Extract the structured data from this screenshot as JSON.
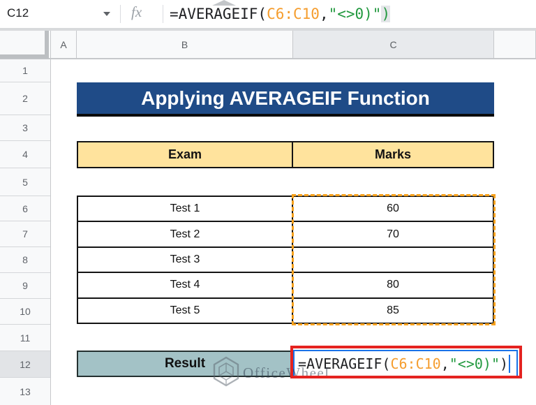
{
  "formula_bar": {
    "name_box": "C12",
    "fx_label": "fx",
    "segments": [
      {
        "t": "=AVERAGEIF(",
        "c": "ink"
      },
      {
        "t": "C6:C10",
        "c": "range"
      },
      {
        "t": ",",
        "c": "ink"
      },
      {
        "t": "\"<>0)\"",
        "c": "string"
      },
      {
        "t": ")",
        "c": "string",
        "highlighted": true
      }
    ]
  },
  "sheet": {
    "column_headers": [
      "A",
      "B",
      "C"
    ],
    "selected_column": "C",
    "row_headers": [
      "1",
      "2",
      "3",
      "4",
      "5",
      "6",
      "7",
      "8",
      "9",
      "10",
      "11",
      "12",
      "13"
    ],
    "selected_row": "12"
  },
  "banner": {
    "title": "Applying AVERAGEIF Function"
  },
  "table": {
    "headers": [
      "Exam",
      "Marks"
    ],
    "rows": [
      {
        "exam": "Test 1",
        "marks": "60"
      },
      {
        "exam": "Test 2",
        "marks": "70"
      },
      {
        "exam": "Test 3",
        "marks": ""
      },
      {
        "exam": "Test 4",
        "marks": "80"
      },
      {
        "exam": "Test 5",
        "marks": "85"
      }
    ]
  },
  "result": {
    "label": "Result",
    "segments": [
      {
        "t": "=AVERAGEIF(",
        "c": "ink"
      },
      {
        "t": "C6:C10",
        "c": "range"
      },
      {
        "t": ",",
        "c": "ink"
      },
      {
        "t": "\"<>0)\"",
        "c": "string"
      },
      {
        "t": ")",
        "c": "ink"
      }
    ]
  },
  "watermark": {
    "text": "OfficeWheel"
  },
  "colors": {
    "banner_bg": "#1f4b87",
    "header_bg": "#ffe39d",
    "result_bg": "#a3c2c6",
    "range_highlight": "#f7a11c",
    "annotation_red": "#e42320",
    "formula_range": "#f59d2e",
    "formula_string": "#22993f",
    "edit_border_blue": "#1a73e8"
  }
}
